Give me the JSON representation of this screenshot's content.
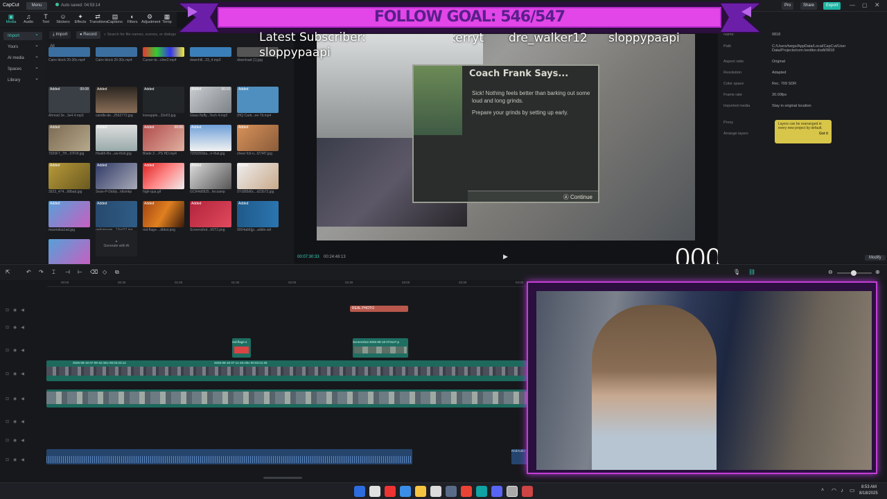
{
  "app": {
    "logo": "CapCut",
    "menu": "Menu",
    "autosave": "Auto saved: 04:53:14",
    "buttons": [
      "Pro",
      "Share",
      "Export"
    ]
  },
  "toolbar": [
    {
      "label": "Media",
      "icon": "media-icon"
    },
    {
      "label": "Audio",
      "icon": "audio-icon"
    },
    {
      "label": "Text",
      "icon": "text-icon"
    },
    {
      "label": "Stickers",
      "icon": "stickers-icon"
    },
    {
      "label": "Effects",
      "icon": "effects-icon"
    },
    {
      "label": "Transitions",
      "icon": "transitions-icon"
    },
    {
      "label": "Captions",
      "icon": "captions-icon"
    },
    {
      "label": "Filters",
      "icon": "filters-icon"
    },
    {
      "label": "Adjustment",
      "icon": "adjustment-icon"
    },
    {
      "label": "Temp",
      "icon": "template-icon"
    }
  ],
  "leftnav": [
    "Import",
    "Yours",
    "AI media",
    "Spaces",
    "Library"
  ],
  "media": {
    "import_label": "Import",
    "record_label": "Record",
    "search_placeholder": "Search for file names, scenes, or dialogs",
    "all_label": "All",
    "items": [
      {
        "name": "Cairo block 20-30x.mp4",
        "badge": "",
        "dur": ""
      },
      {
        "name": "Cairo block 20-30x.mp4",
        "badge": "",
        "dur": ""
      },
      {
        "name": "Cursor-te...cher2.mp4",
        "badge": "",
        "dur": ""
      },
      {
        "name": "downhill...23_4.mp3",
        "badge": "",
        "dur": ""
      },
      {
        "name": "download (1).jpg",
        "badge": "",
        "dur": ""
      },
      {
        "name": "Ahmad 3e...3e4.4.mp3",
        "badge": "Added",
        "dur": "00:08"
      },
      {
        "name": "candle-de...2562772.jpg",
        "badge": "Added",
        "dur": ""
      },
      {
        "name": "loveapple...32e63.jpg",
        "badge": "Added",
        "dur": ""
      },
      {
        "name": "Glass fluffy...Tech 4.mp3",
        "badge": "Added",
        "dur": "00:10"
      },
      {
        "name": "(HQ Carb...ee-Tit.mp4",
        "badge": "Added",
        "dur": ""
      },
      {
        "name": "7920F7_TH...07F0f.jpg",
        "badge": "Added",
        "dur": ""
      },
      {
        "name": "Health-Bo...sw-thsh.jpg",
        "badge": "Added",
        "dur": ""
      },
      {
        "name": "Blade 3 ...PS HD.mp4",
        "badge": "Added",
        "dur": "00:06"
      },
      {
        "name": "7209250ba...rr-that.jpg",
        "badge": "Added",
        "dur": ""
      },
      {
        "name": "cheer fcti-n...f274f7.jpg",
        "badge": "Added",
        "dur": ""
      },
      {
        "name": "3923_474...98bad.jpg",
        "badge": "Added",
        "dur": ""
      },
      {
        "name": "Sean-P-Diddy...ntlsmkp",
        "badge": "Added",
        "dur": ""
      },
      {
        "name": "high-qua.gif",
        "badge": "Added",
        "dur": ""
      },
      {
        "name": "GCR4d0825...fecsamp",
        "badge": "Added",
        "dur": ""
      },
      {
        "name": "97c885d6c...d22b73.jpg",
        "badge": "Added",
        "dur": ""
      },
      {
        "name": "maxmdsa1ad.jpg",
        "badge": "Added",
        "dur": ""
      },
      {
        "name": "gettyimage...12ed12.jpg",
        "badge": "Added",
        "dur": ""
      },
      {
        "name": "red-flags-...dbkst.png",
        "badge": "Added",
        "dur": ""
      },
      {
        "name": "Screenshot...h5T2.png",
        "badge": "Added",
        "dur": ""
      },
      {
        "name": "9004ab6(jp...addin.sid",
        "badge": "Added",
        "dur": ""
      },
      {
        "name": "Screensho...742A3.png",
        "badge": "",
        "dur": ""
      }
    ],
    "ai_label": "Generate with AI"
  },
  "player": {
    "time_current": "00:07:30:33",
    "time_total": "00:24:48:13",
    "popup_title": "Coach Frank Says...",
    "popup_line1": "Sick! Nothing feels better than barking out some loud and long grinds.",
    "popup_line2": "Prepare your grinds by setting up early.",
    "popup_continue": "Continue",
    "timer": "000"
  },
  "overlay": {
    "goal": "FOLLOW GOAL: 546/547",
    "sub_label": "Latest Subscriber:",
    "sub_name": "sloppypaapi",
    "ticker": [
      "kerryt",
      "dre_walker12",
      "sloppypaapi"
    ]
  },
  "props": {
    "rows": [
      {
        "k": "Name",
        "v": "0818"
      },
      {
        "k": "Path",
        "v": "C:/Users/twigs/AppData/Local/CapCut/User Data/Projects/com.lveditor.draft/0818"
      },
      {
        "k": "Aspect ratio",
        "v": "Original"
      },
      {
        "k": "Resolution",
        "v": "Adapted"
      },
      {
        "k": "Color space",
        "v": "Rec. 709 SDR"
      },
      {
        "k": "Frame rate",
        "v": "30.00fps"
      },
      {
        "k": "Imported media",
        "v": "Stay in original location"
      },
      {
        "k": "Proxy",
        "v": ""
      },
      {
        "k": "Arrange layers",
        "v": ""
      }
    ],
    "tooltip": "Layers can be rearranged in every new project by default.",
    "tooltip_btn": "Got it",
    "modify": "Modify"
  },
  "timeline": {
    "ruler": [
      "00:00",
      "00:30",
      "01:00",
      "01:30",
      "02:00",
      "02:30",
      "03:00",
      "03:30",
      "04:00"
    ],
    "clip_text": "REAL PHOTO",
    "clip_small": "red-flags-s",
    "clip_shot": "Screenshot 2025-08-18 073127.p",
    "main_a": "2025-08-18 07-09-42.mkv 00:03:23:12",
    "main_b": "2025-08-18 07-11-48.mkv 00:03:21:25",
    "audio_end": "RedAudio"
  },
  "clock": {
    "time": "8:53 AM",
    "date": "8/18/2025"
  }
}
